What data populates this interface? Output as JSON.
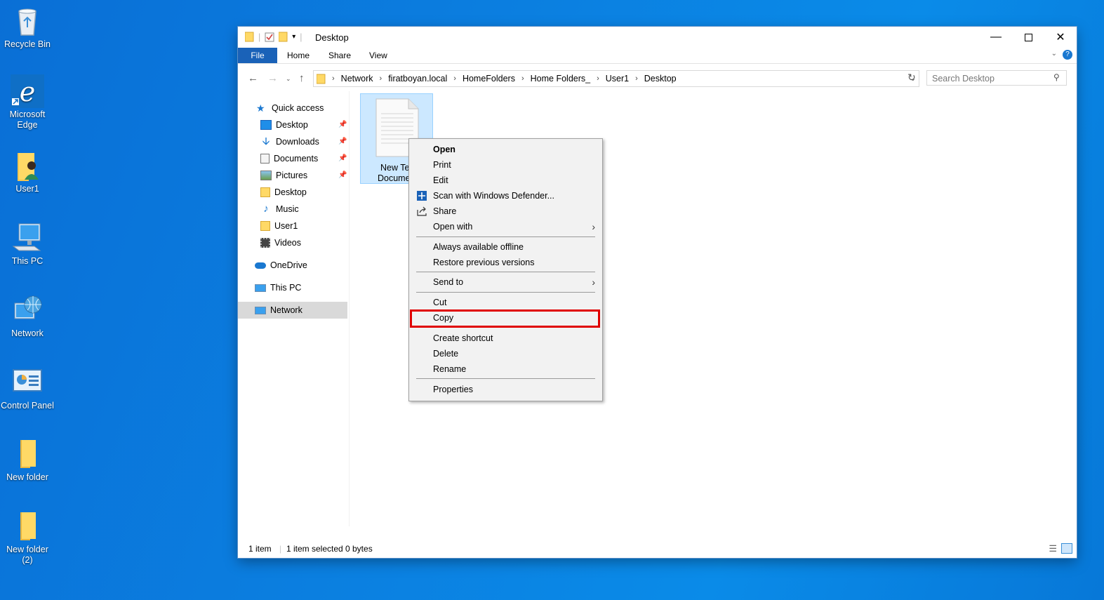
{
  "desktop": {
    "icons": [
      {
        "label": "Recycle Bin"
      },
      {
        "label": "Microsoft Edge"
      },
      {
        "label": "User1"
      },
      {
        "label": "This PC"
      },
      {
        "label": "Network"
      },
      {
        "label": "Control Panel"
      },
      {
        "label": "New folder"
      },
      {
        "label": "New folder (2)"
      }
    ]
  },
  "window": {
    "title": "Desktop",
    "ribbon": {
      "file": "File",
      "home": "Home",
      "share": "Share",
      "view": "View"
    },
    "address": {
      "crumbs": [
        "Network",
        "firatboyan.local",
        "HomeFolders",
        "Home Folders_",
        "User1",
        "Desktop"
      ]
    },
    "search": {
      "placeholder": "Search Desktop"
    },
    "nav": {
      "quick_access": "Quick access",
      "items": [
        {
          "label": "Desktop",
          "pinned": true
        },
        {
          "label": "Downloads",
          "pinned": true
        },
        {
          "label": "Documents",
          "pinned": true
        },
        {
          "label": "Pictures",
          "pinned": true
        },
        {
          "label": "Desktop",
          "pinned": false
        },
        {
          "label": "Music",
          "pinned": false
        },
        {
          "label": "User1",
          "pinned": false
        },
        {
          "label": "Videos",
          "pinned": false
        }
      ],
      "onedrive": "OneDrive",
      "this_pc": "This PC",
      "network": "Network"
    },
    "file": {
      "line1": "New Tex",
      "line2": "Docume"
    },
    "status": {
      "count": "1 item",
      "selected": "1 item selected",
      "size": "0 bytes"
    }
  },
  "context_menu": {
    "items": [
      {
        "label": "Open",
        "bold": true
      },
      {
        "label": "Print"
      },
      {
        "label": "Edit"
      },
      {
        "label": "Scan with Windows Defender...",
        "icon": "defender-shield-icon"
      },
      {
        "label": "Share",
        "icon": "share-icon"
      },
      {
        "label": "Open with",
        "submenu": true
      },
      {
        "label": "Always available offline"
      },
      {
        "label": "Restore previous versions"
      },
      {
        "label": "Send to",
        "submenu": true
      },
      {
        "label": "Cut"
      },
      {
        "label": "Copy",
        "highlighted": true
      },
      {
        "label": "Create shortcut"
      },
      {
        "label": "Delete"
      },
      {
        "label": "Rename"
      },
      {
        "label": "Properties"
      }
    ],
    "highlight_color": "#e00000"
  },
  "colors": {
    "desktop_bg": "#0a7fe0",
    "accent": "#1a62b8",
    "selection": "#cce8ff"
  }
}
